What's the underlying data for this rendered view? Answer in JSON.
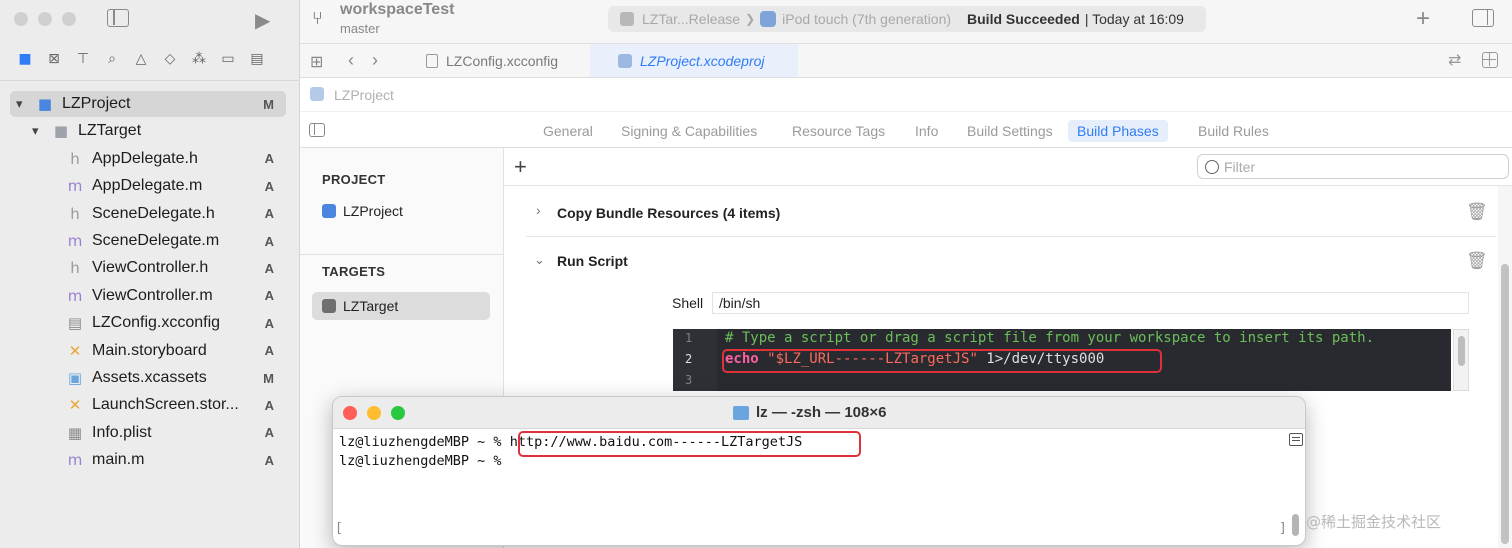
{
  "navigator": {
    "files": [
      {
        "name": "LZProject",
        "status": "M",
        "icon": "xcode-project-icon",
        "indent": 0,
        "disclosure": "▾",
        "selected": true
      },
      {
        "name": "LZTarget",
        "status": "",
        "icon": "folder-icon",
        "indent": 1,
        "disclosure": "▾"
      },
      {
        "name": "AppDelegate.h",
        "status": "A",
        "icon": "header-file-icon",
        "indent": 2
      },
      {
        "name": "AppDelegate.m",
        "status": "A",
        "icon": "objc-file-icon",
        "indent": 2
      },
      {
        "name": "SceneDelegate.h",
        "status": "A",
        "icon": "header-file-icon",
        "indent": 2
      },
      {
        "name": "SceneDelegate.m",
        "status": "A",
        "icon": "objc-file-icon",
        "indent": 2
      },
      {
        "name": "ViewController.h",
        "status": "A",
        "icon": "header-file-icon",
        "indent": 2
      },
      {
        "name": "ViewController.m",
        "status": "A",
        "icon": "objc-file-icon",
        "indent": 2
      },
      {
        "name": "LZConfig.xcconfig",
        "status": "A",
        "icon": "config-file-icon",
        "indent": 2
      },
      {
        "name": "Main.storyboard",
        "status": "A",
        "icon": "storyboard-icon",
        "indent": 2
      },
      {
        "name": "Assets.xcassets",
        "status": "M",
        "icon": "assets-icon",
        "indent": 2
      },
      {
        "name": "LaunchScreen.stor...",
        "status": "A",
        "icon": "storyboard-icon",
        "indent": 2
      },
      {
        "name": "Info.plist",
        "status": "A",
        "icon": "plist-icon",
        "indent": 2
      },
      {
        "name": "main.m",
        "status": "A",
        "icon": "objc-file-icon",
        "indent": 2
      }
    ]
  },
  "toolbar": {
    "project_name": "workspaceTest",
    "branch": "master",
    "scheme": "LZTar...Release",
    "separator": "❯",
    "device": "iPod touch (7th generation)",
    "status_bold": "Build Succeeded",
    "status_time": "| Today at 16:09",
    "add": "+"
  },
  "editor_tabs": [
    {
      "label": "LZConfig.xcconfig",
      "active": false
    },
    {
      "label": "LZProject.xcodeproj",
      "active": true
    }
  ],
  "breadcrumb": "LZProject",
  "settings_tabs": [
    "General",
    "Signing & Capabilities",
    "Resource Tags",
    "Info",
    "Build Settings",
    "Build Phases",
    "Build Rules"
  ],
  "active_settings_tab": "Build Phases",
  "targets_panel": {
    "project_header": "PROJECT",
    "project_item": "LZProject",
    "targets_header": "TARGETS",
    "target_item": "LZTarget"
  },
  "phases": {
    "add": "+",
    "filter_placeholder": "Filter",
    "copy_bundle": "Copy Bundle Resources (4 items)",
    "run_script": "Run Script",
    "shell_label": "Shell",
    "shell_value": "/bin/sh",
    "code_lines": [
      {
        "num": "1",
        "comment": "# Type a script or drag a script file from your workspace to insert its path."
      },
      {
        "num": "2",
        "keyword": "echo",
        "string": "\"$LZ_URL------LZTargetJS\"",
        "rest": " 1>/dev/ttys000"
      },
      {
        "num": "3"
      }
    ]
  },
  "terminal": {
    "title": "lz — -zsh — 108×6",
    "prompt": "lz@liuzhengdeMBP ~ %",
    "output": "http://www.baidu.com------LZTargetJS",
    "left_bracket": "[",
    "right_bracket": "]"
  },
  "watermark": "@稀土掘金技术社区",
  "colors": {
    "accent": "#2f7cf6",
    "highlight": "#e0303a",
    "code_bg": "#292a30",
    "comment": "#6bbf59",
    "keyword": "#fc5fa3",
    "string": "#fc6a5d"
  }
}
